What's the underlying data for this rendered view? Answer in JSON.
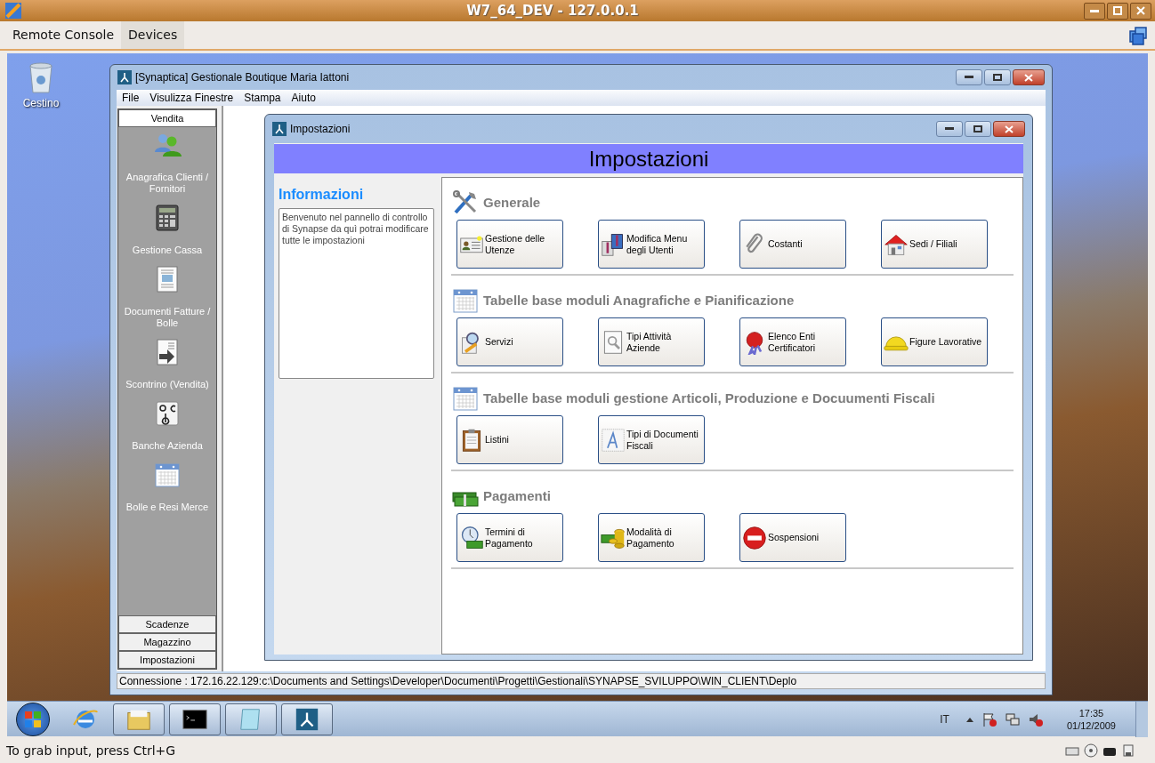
{
  "host_window": {
    "title": "W7_64_DEV - 127.0.0.1"
  },
  "host_menu": [
    {
      "label": "Remote Console",
      "selected": false
    },
    {
      "label": "Devices",
      "selected": true
    }
  ],
  "desktop_icons": [
    {
      "label": "Cestino"
    }
  ],
  "app_window": {
    "title": "[Synaptica] Gestionale Boutique Maria Iattoni",
    "menu": [
      "File",
      "Visulizza Finestre",
      "Stampa",
      "Aiuto"
    ],
    "sidebar": {
      "groups": [
        {
          "label": "Vendita",
          "selected": true
        },
        {
          "label": "Scadenze",
          "selected": false
        },
        {
          "label": "Magazzino",
          "selected": false
        },
        {
          "label": "Impostazioni",
          "selected": false
        }
      ],
      "items": [
        "Anagrafica Clienti / Fornitori",
        "Gestione Cassa",
        "Documenti Fatture / Bolle",
        "Scontrino (Vendita)",
        "Banche Azienda",
        "Bolle e Resi Merce"
      ]
    },
    "status_bar": "Connessione : 172.16.22.129:c:\\Documents and Settings\\Developer\\Documenti\\Progetti\\Gestionali\\SYNAPSE_SVILUPPO\\WIN_CLIENT\\Deplo"
  },
  "settings_window": {
    "title": "Impostazioni",
    "banner": "Impostazioni",
    "info": {
      "heading": "Informazioni",
      "text": "Benvenuto nel pannello di controllo di Synapse da quì potrai modificare tutte le impostazioni"
    },
    "sections": [
      {
        "title": "Generale",
        "buttons": [
          "Gestione delle Utenze",
          "Modifica Menu degli Utenti",
          "Costanti",
          "Sedi / Filiali"
        ]
      },
      {
        "title": "Tabelle base moduli Anagrafiche e Pianificazione",
        "buttons": [
          "Servizi",
          "Tipi Attività Aziende",
          "Elenco Enti Certificatori",
          "Figure Lavorative"
        ]
      },
      {
        "title": "Tabelle base moduli gestione Articoli, Produzione e Docuumenti Fiscali",
        "buttons": [
          "Listini",
          "Tipi di Documenti Fiscali"
        ]
      },
      {
        "title": "Pagamenti",
        "buttons": [
          "Termini di Pagamento",
          "Modalità di Pagamento",
          "Sospensioni"
        ]
      }
    ]
  },
  "taskbar": {
    "language": "IT",
    "time": "17:35",
    "date": "01/12/2009"
  },
  "host_status": "To grab input, press Ctrl+G"
}
